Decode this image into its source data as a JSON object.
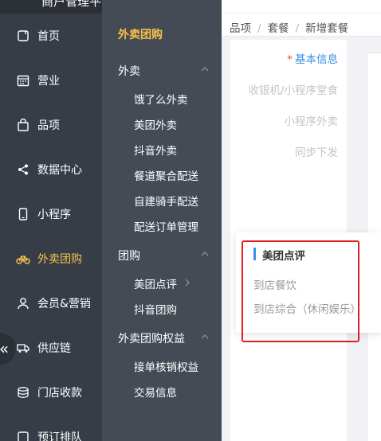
{
  "app": {
    "partial_title": "商户管理平台"
  },
  "nav1": {
    "items": [
      {
        "label": "首页",
        "icon": "home-icon"
      },
      {
        "label": "营业",
        "icon": "calendar-icon"
      },
      {
        "label": "品项",
        "icon": "bag-icon"
      },
      {
        "label": "数据中心",
        "icon": "share-icon"
      },
      {
        "label": "小程序",
        "icon": "phone-icon"
      },
      {
        "label": "外卖团购",
        "icon": "bike-icon"
      },
      {
        "label": "会员&营销",
        "icon": "user-icon"
      },
      {
        "label": "供应链",
        "icon": "truck-icon"
      },
      {
        "label": "门店收款",
        "icon": "coins-icon"
      },
      {
        "label": "预订排队",
        "icon": "queue-icon"
      }
    ],
    "active_index": 5,
    "collapse_glyph": "«"
  },
  "nav2": {
    "title": "外卖团购",
    "groups": [
      {
        "label": "外卖",
        "items": [
          "饿了么外卖",
          "美团外卖",
          "抖音外卖",
          "餐道聚合配送",
          "自建骑手配送",
          "配送订单管理"
        ]
      },
      {
        "label": "团购",
        "items": [
          "美团点评",
          "抖音团购"
        ]
      },
      {
        "label": "外卖团购权益",
        "items": [
          "接单核销权益",
          "交易信息"
        ]
      }
    ]
  },
  "breadcrumb": {
    "items": [
      "品项",
      "套餐",
      "新增套餐"
    ],
    "separator": "/"
  },
  "tabs": {
    "required_mark": "*",
    "active_label": "基本信息",
    "others": [
      "收银机/小程序堂食",
      "小程序外卖",
      "同步下发"
    ]
  },
  "popover": {
    "header": "美团点评",
    "options": [
      "到店餐饮",
      "到店综合（休闲娱乐）"
    ]
  },
  "colors": {
    "accent": "#3a8ee6",
    "active_nav": "#f7c14b",
    "highlight": "#e02020"
  }
}
